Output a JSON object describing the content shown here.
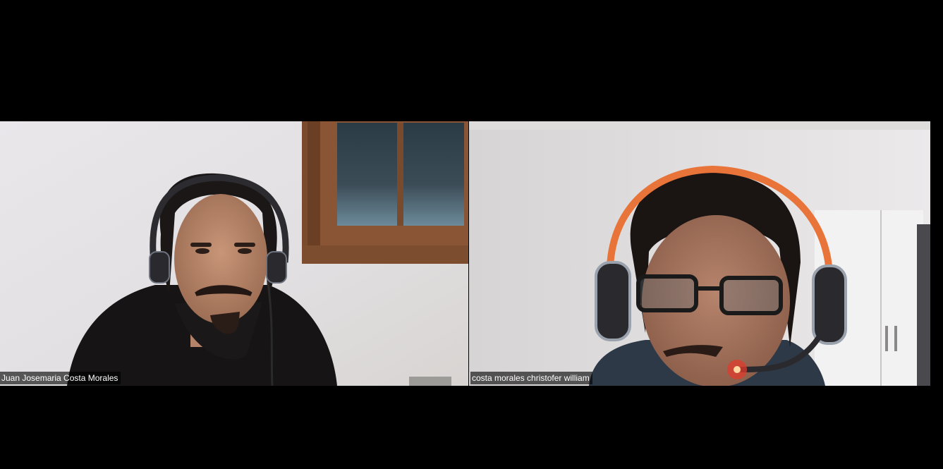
{
  "meeting": {
    "participants": [
      {
        "display_name": "Juan Josemaria Costa Morales"
      },
      {
        "display_name": "costa morales christofer william"
      }
    ]
  },
  "colors": {
    "background": "#000000",
    "name_tag_text": "#ffffff"
  },
  "icons": [
    "headset-icon",
    "mic-led-icon"
  ]
}
